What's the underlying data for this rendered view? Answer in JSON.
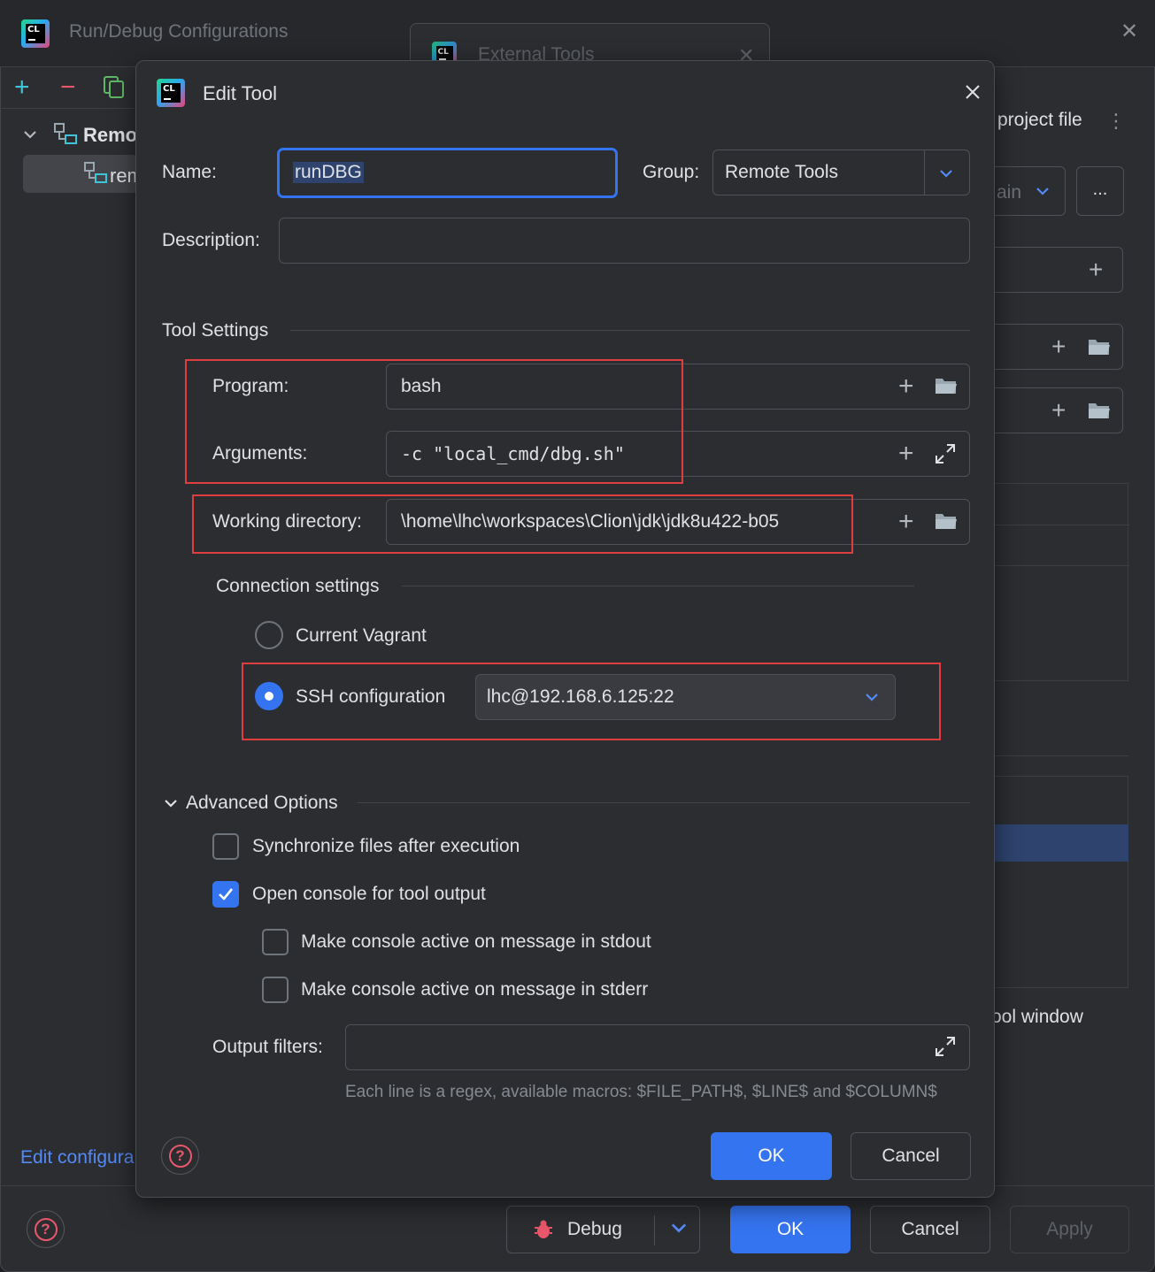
{
  "background_window": {
    "title": "Run/Debug Configurations",
    "tab_title": "External Tools",
    "tree": {
      "group_label": "Remo",
      "item_label": "rem"
    },
    "right_panel": {
      "project_file": "project file",
      "combo_peek": "ain",
      "dots_label": "...",
      "tool_window": "ool window"
    },
    "edit_configurations_link": "Edit configura",
    "buttons": {
      "debug": "Debug",
      "ok": "OK",
      "cancel": "Cancel",
      "apply": "Apply"
    }
  },
  "dialog": {
    "title": "Edit Tool",
    "name_label": "Name:",
    "name_value": "runDBG",
    "group_label": "Group:",
    "group_value": "Remote Tools",
    "description_label": "Description:",
    "description_value": "",
    "tool_settings": {
      "heading": "Tool Settings",
      "program_label": "Program:",
      "program_value": "bash",
      "arguments_label": "Arguments:",
      "arguments_value": "-c \"local_cmd/dbg.sh\"",
      "working_dir_label": "Working directory:",
      "working_dir_value": "\\home\\lhc\\workspaces\\Clion\\jdk\\jdk8u422-b05"
    },
    "connection": {
      "heading": "Connection settings",
      "option_vagrant": "Current Vagrant",
      "option_ssh": "SSH configuration",
      "selected": "SSH configuration",
      "ssh_value": "lhc@192.168.6.125:22"
    },
    "advanced": {
      "heading": "Advanced Options",
      "sync_files": {
        "label": "Synchronize files after execution",
        "checked": false
      },
      "open_console": {
        "label": "Open console for tool output",
        "checked": true
      },
      "active_stdout": {
        "label": "Make console active on message in stdout",
        "checked": false
      },
      "active_stderr": {
        "label": "Make console active on message in stderr",
        "checked": false
      },
      "output_filters_label": "Output filters:",
      "output_filters_value": "",
      "hint": "Each line is a regex, available macros: $FILE_PATH$, $LINE$ and $COLUMN$"
    },
    "buttons": {
      "ok": "OK",
      "cancel": "Cancel"
    }
  },
  "colors": {
    "accent": "#3574f0",
    "highlight_box": "#e03e3e",
    "background": "#2b2d30",
    "text": "#dfe1e5"
  }
}
